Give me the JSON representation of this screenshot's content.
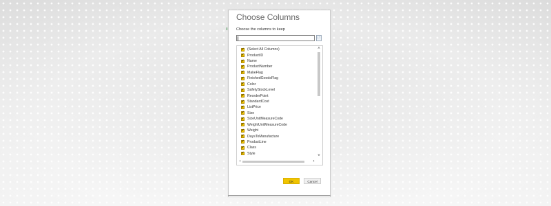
{
  "dialog": {
    "title": "Choose Columns",
    "subtitle": "Choose the columns to keep",
    "search": {
      "value": "",
      "placeholder": ""
    },
    "sort_icon_glyph": "↓↑",
    "columns": [
      {
        "label": "(Select All Columns)",
        "checked": true
      },
      {
        "label": "ProductID",
        "checked": true
      },
      {
        "label": "Name",
        "checked": true
      },
      {
        "label": "ProductNumber",
        "checked": true
      },
      {
        "label": "MakeFlag",
        "checked": true
      },
      {
        "label": "FinishedGoodsFlag",
        "checked": true
      },
      {
        "label": "Color",
        "checked": true
      },
      {
        "label": "SafetyStockLevel",
        "checked": true
      },
      {
        "label": "ReorderPoint",
        "checked": true
      },
      {
        "label": "StandardCost",
        "checked": true
      },
      {
        "label": "ListPrice",
        "checked": true
      },
      {
        "label": "Size",
        "checked": true
      },
      {
        "label": "SizeUnitMeasureCode",
        "checked": true
      },
      {
        "label": "WeightUnitMeasureCode",
        "checked": true
      },
      {
        "label": "Weight",
        "checked": true
      },
      {
        "label": "DaysToManufacture",
        "checked": true
      },
      {
        "label": "ProductLine",
        "checked": true
      },
      {
        "label": "Class",
        "checked": true
      },
      {
        "label": "Style",
        "checked": true
      }
    ],
    "ok_label": "OK",
    "cancel_label": "Cancel"
  },
  "colors": {
    "accent": "#f0c400",
    "title_text": "#666666"
  }
}
